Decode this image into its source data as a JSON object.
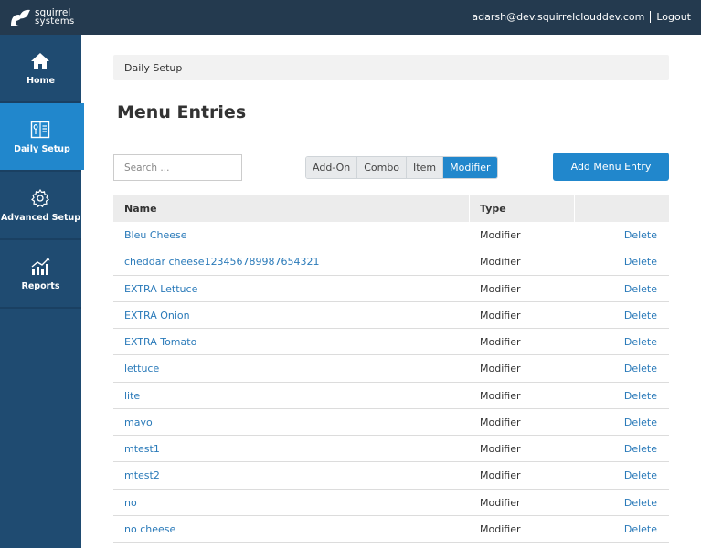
{
  "brand": {
    "line1": "squirrel",
    "line2": "systems"
  },
  "user": {
    "email": "adarsh@dev.squirrelclouddev.com",
    "logout_label": "Logout"
  },
  "sidebar": {
    "items": [
      {
        "label": "Home",
        "icon": "home-icon"
      },
      {
        "label": "Daily Setup",
        "icon": "menu-book-icon"
      },
      {
        "label": "Advanced Setup",
        "icon": "gear-icon"
      },
      {
        "label": "Reports",
        "icon": "bar-chart-icon"
      }
    ],
    "active": "Daily Setup"
  },
  "breadcrumb": "Daily Setup",
  "page_title": "Menu Entries",
  "search": {
    "placeholder": "Search ...",
    "value": ""
  },
  "filters": {
    "options": [
      "Add-On",
      "Combo",
      "Item",
      "Modifier"
    ],
    "selected": "Modifier"
  },
  "add_button": "Add Menu Entry",
  "table": {
    "headers": {
      "name": "Name",
      "type": "Type"
    },
    "delete_label": "Delete",
    "rows": [
      {
        "name": "Bleu Cheese",
        "type": "Modifier"
      },
      {
        "name": "cheddar cheese123456789987654321",
        "type": "Modifier"
      },
      {
        "name": "EXTRA Lettuce",
        "type": "Modifier"
      },
      {
        "name": "EXTRA Onion",
        "type": "Modifier"
      },
      {
        "name": "EXTRA Tomato",
        "type": "Modifier"
      },
      {
        "name": "lettuce",
        "type": "Modifier"
      },
      {
        "name": "lite",
        "type": "Modifier"
      },
      {
        "name": "mayo",
        "type": "Modifier"
      },
      {
        "name": "mtest1",
        "type": "Modifier"
      },
      {
        "name": "mtest2",
        "type": "Modifier"
      },
      {
        "name": "no",
        "type": "Modifier"
      },
      {
        "name": "no cheese",
        "type": "Modifier"
      }
    ]
  },
  "colors": {
    "topbar": "#243a4f",
    "sidebar": "#1f4b71",
    "accent": "#2187cc",
    "link": "#2a7ab9"
  }
}
